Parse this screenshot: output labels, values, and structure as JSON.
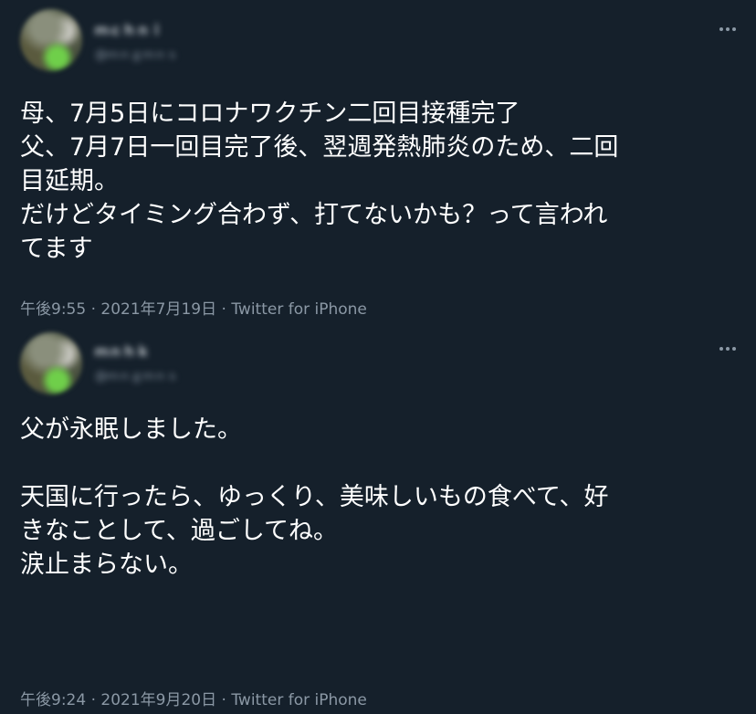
{
  "tweets": [
    {
      "author_name": "ｍｃｈｎｉ",
      "author_handle": "@ｍｎｇｍｎｓ",
      "text_lines": [
        "母、7月5日にコロナワクチン二回目接種完了",
        "父、7月7日一回目完了後、翌週発熱肺炎のため、二回",
        "目延期。",
        "だけどタイミング合わず、打てないかも？って言われ",
        "てます"
      ],
      "time": "午後9:55",
      "date": "2021年7月19日",
      "separator": "·",
      "source": "Twitter for iPhone"
    },
    {
      "author_name": "ｍｎｈｋ",
      "author_handle": "@ｍｎｇｍｎｓ",
      "text_lines": [
        "父が永眠しました。",
        "",
        "天国に行ったら、ゆっくり、美味しいもの食べて、好",
        "きなことして、過ごしてね。",
        "涙止まらない。"
      ],
      "time": "午後9:24",
      "date": "2021年9月20日",
      "separator": "·",
      "source": "Twitter for iPhone"
    }
  ],
  "icons": {
    "more": "more-horizontal-icon",
    "avatar": "avatar"
  },
  "colors": {
    "background": "#15202b",
    "text": "#ffffff",
    "secondary_text": "#8b98a5"
  }
}
